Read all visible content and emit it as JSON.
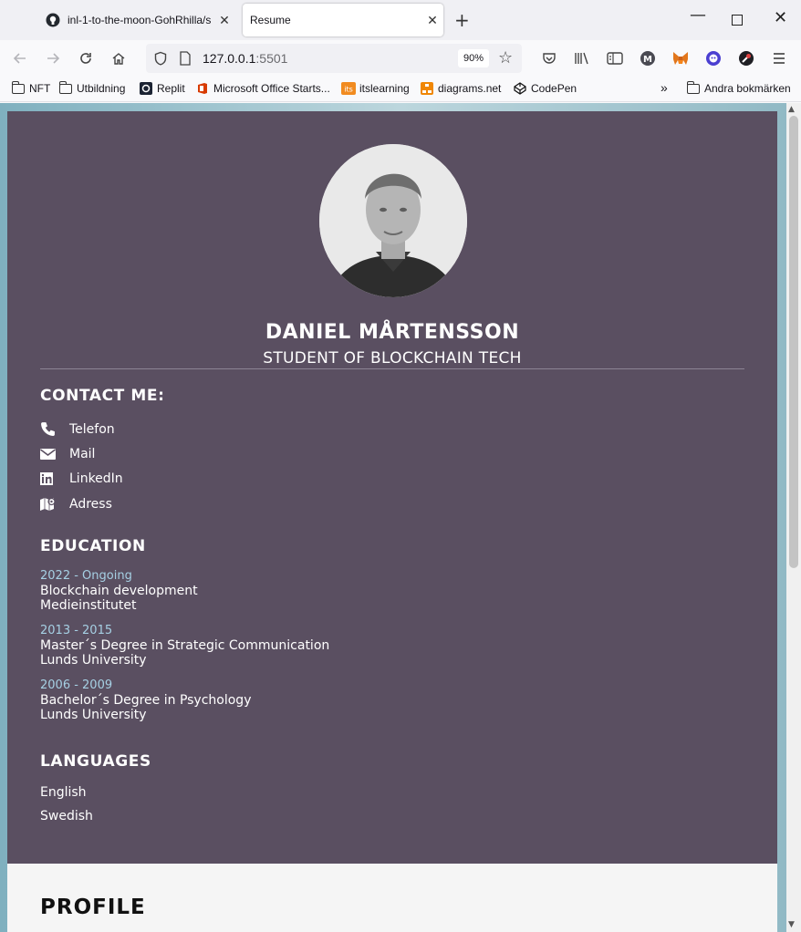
{
  "browser": {
    "tabs": [
      {
        "title": "inl-1-to-the-moon-GohRhilla/s",
        "active": false,
        "close": "✕"
      },
      {
        "title": "Resume",
        "active": true,
        "close": "✕"
      }
    ],
    "new_tab": "+",
    "window_controls": {
      "minimize": "—",
      "close": "✕"
    },
    "url": {
      "host": "127.0.0.1",
      "port": ":5501"
    },
    "zoom": "90%",
    "bookmarks": [
      {
        "label": "NFT",
        "icon": "folder-icon"
      },
      {
        "label": "Utbildning",
        "icon": "folder-icon"
      },
      {
        "label": "Replit",
        "icon": "replit-icon"
      },
      {
        "label": "Microsoft Office Starts...",
        "icon": "office-icon"
      },
      {
        "label": "itslearning",
        "icon": "itslearning-icon"
      },
      {
        "label": "diagrams.net",
        "icon": "diagrams-icon"
      },
      {
        "label": "CodePen",
        "icon": "codepen-icon"
      }
    ],
    "more_bookmarks": "»",
    "other_bookmarks": "Andra bokmärken"
  },
  "resume": {
    "name": "DANIEL MÅRTENSSON",
    "title": "STUDENT OF BLOCKCHAIN TECH",
    "contact": {
      "heading": "CONTACT ME:",
      "items": [
        {
          "label": "Telefon",
          "icon": "phone-icon"
        },
        {
          "label": "Mail",
          "icon": "mail-icon"
        },
        {
          "label": "LinkedIn",
          "icon": "linkedin-icon"
        },
        {
          "label": "Adress",
          "icon": "map-icon"
        }
      ]
    },
    "education": {
      "heading": "EDUCATION",
      "items": [
        {
          "years": "2022 - Ongoing",
          "degree": "Blockchain development",
          "school": "Medieinstitutet"
        },
        {
          "years": "2013 - 2015",
          "degree": "Master´s Degree in Strategic Communication",
          "school": "Lunds University"
        },
        {
          "years": "2006 - 2009",
          "degree": "Bachelor´s Degree in Psychology",
          "school": "Lunds University"
        }
      ]
    },
    "languages": {
      "heading": "LANGUAGES",
      "items": [
        "English",
        "Swedish"
      ]
    },
    "profile": {
      "heading": "PROFILE"
    }
  },
  "colors": {
    "panel": "#5a4f61",
    "years": "#a6d0e4",
    "sheet": "#f5f5f5"
  }
}
